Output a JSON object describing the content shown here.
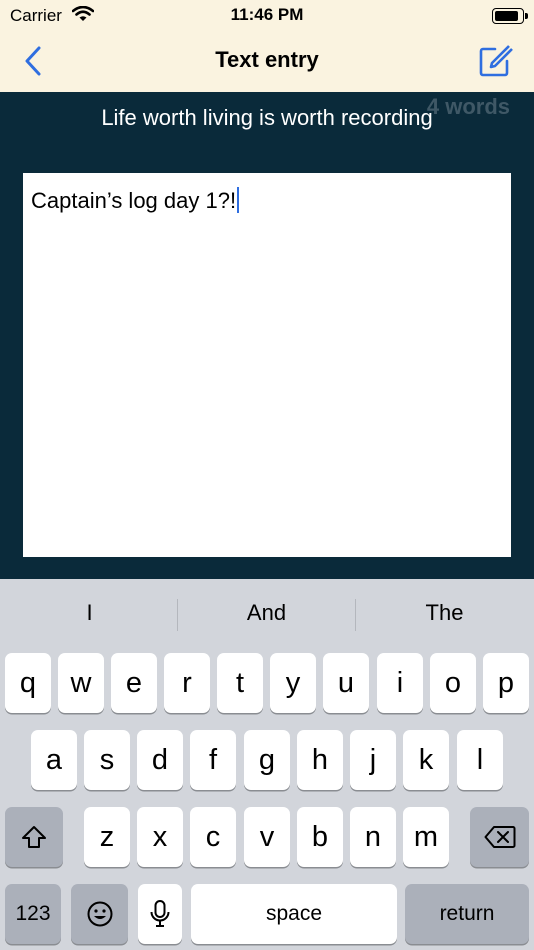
{
  "status_bar": {
    "carrier": "Carrier",
    "time": "11:46 PM",
    "battery_level": 0.9
  },
  "nav": {
    "title": "Text entry",
    "back_icon": "chevron-left-icon",
    "compose_icon": "compose-icon"
  },
  "content": {
    "tagline": "Life worth living is worth recording",
    "word_count": "4 words",
    "entry_text": "Captain’s log day 1?!"
  },
  "keyboard": {
    "suggestions": [
      "I",
      "And",
      "The"
    ],
    "row1": [
      "q",
      "w",
      "e",
      "r",
      "t",
      "y",
      "u",
      "i",
      "o",
      "p"
    ],
    "row2": [
      "a",
      "s",
      "d",
      "f",
      "g",
      "h",
      "j",
      "k",
      "l"
    ],
    "row3": [
      "z",
      "x",
      "c",
      "v",
      "b",
      "n",
      "m"
    ],
    "numbers_label": "123",
    "space_label": "space",
    "return_label": "return"
  },
  "colors": {
    "accent": "#2f6ee0",
    "header_bg": "#faf3e0",
    "content_bg": "#0a2a3a"
  }
}
